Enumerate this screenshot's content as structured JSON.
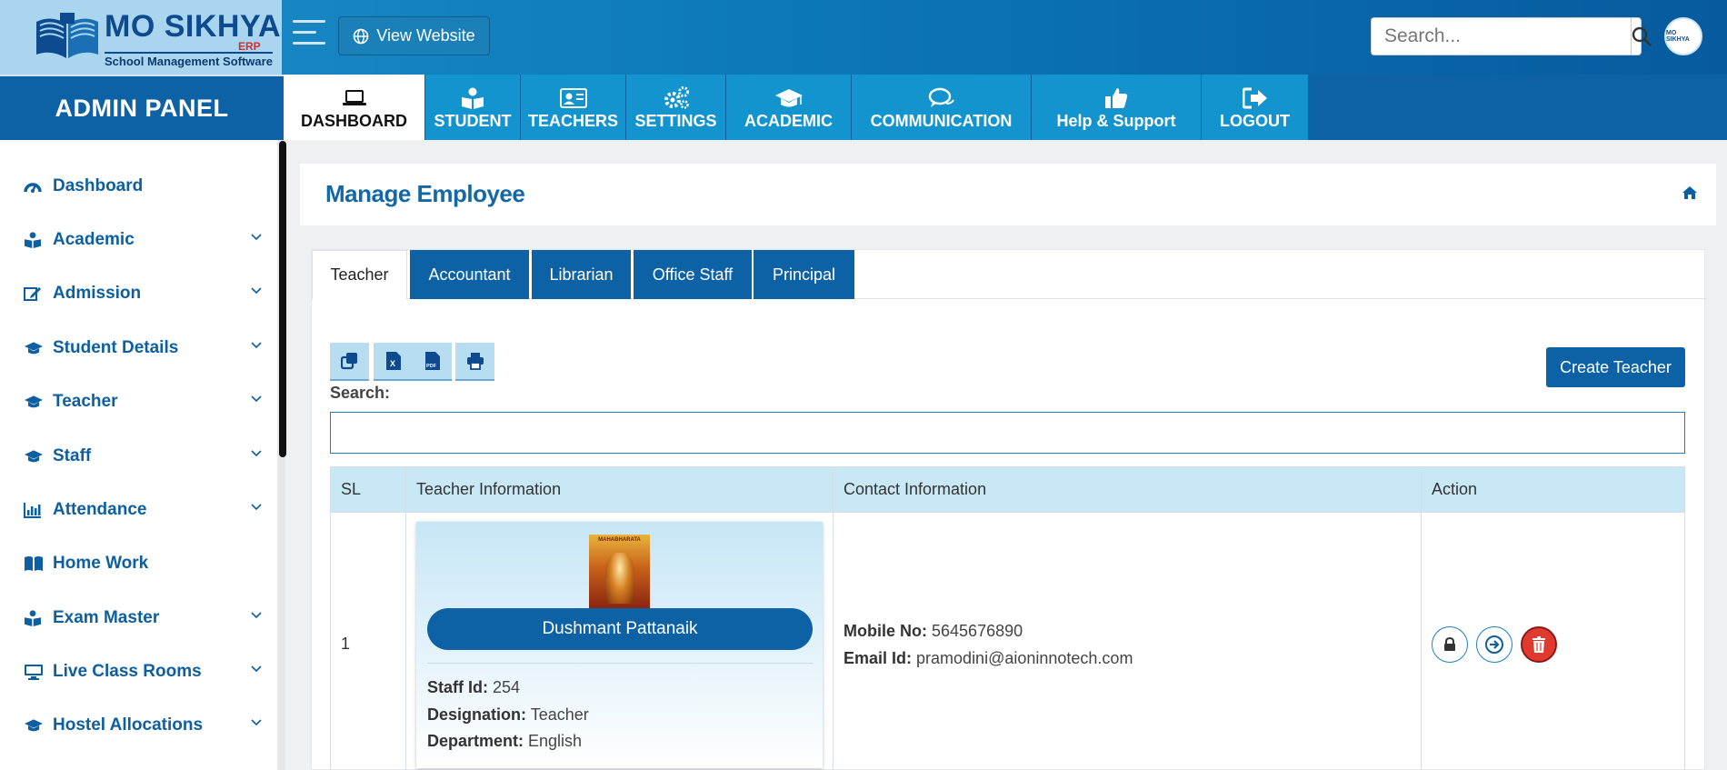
{
  "brand": {
    "name": "MO SIKHYA",
    "erp": "ERP",
    "tagline": "School Management Software",
    "avatar_text": "MO SIKHYA"
  },
  "header": {
    "view_website": "View Website",
    "search_placeholder": "Search..."
  },
  "admin_panel": "ADMIN PANEL",
  "nav": [
    {
      "label": "DASHBOARD",
      "icon": "laptop-icon",
      "active": true
    },
    {
      "label": "STUDENT",
      "icon": "reader-icon"
    },
    {
      "label": "TEACHERS",
      "icon": "id-card-icon"
    },
    {
      "label": "SETTINGS",
      "icon": "gears-icon"
    },
    {
      "label": "ACADEMIC",
      "icon": "graduation-cap-icon"
    },
    {
      "label": "COMMUNICATION",
      "icon": "chat-icon"
    },
    {
      "label": "Help & Support",
      "icon": "thumbs-up-icon"
    },
    {
      "label": "LOGOUT",
      "icon": "sign-out-icon"
    }
  ],
  "sidebar": {
    "items": [
      {
        "label": "Dashboard",
        "icon": "dashboard-icon",
        "has_children": false
      },
      {
        "label": "Academic",
        "icon": "reader-icon",
        "has_children": true
      },
      {
        "label": "Admission",
        "icon": "edit-icon",
        "has_children": true
      },
      {
        "label": "Student Details",
        "icon": "graduation-cap-icon",
        "has_children": true
      },
      {
        "label": "Teacher",
        "icon": "graduation-cap-icon",
        "has_children": true
      },
      {
        "label": "Staff",
        "icon": "graduation-cap-icon",
        "has_children": true
      },
      {
        "label": "Attendance",
        "icon": "bar-chart-icon",
        "has_children": true
      },
      {
        "label": "Home Work",
        "icon": "book-icon",
        "has_children": false
      },
      {
        "label": "Exam Master",
        "icon": "reader-icon",
        "has_children": true
      },
      {
        "label": "Live Class Rooms",
        "icon": "monitor-icon",
        "has_children": true
      },
      {
        "label": "Hostel Allocations",
        "icon": "graduation-cap-icon",
        "has_children": true
      }
    ]
  },
  "page": {
    "title": "Manage Employee",
    "tabs": [
      "Teacher",
      "Accountant",
      "Librarian",
      "Office Staff",
      "Principal"
    ],
    "active_tab": "Teacher",
    "tools": [
      "copy-icon",
      "excel-icon",
      "pdf-icon",
      "print-icon"
    ],
    "create_button": "Create Teacher",
    "search_label": "Search:",
    "search_value": ""
  },
  "table": {
    "headers": [
      "SL",
      "Teacher Information",
      "Contact Information",
      "Action"
    ],
    "rows": [
      {
        "sl": "1",
        "photo_caption": "MAHABHARATA",
        "name": "Dushmant Pattanaik",
        "staff_id_label": "Staff Id:",
        "staff_id": "254",
        "designation_label": "Designation:",
        "designation": "Teacher",
        "department_label": "Department:",
        "department": "English",
        "mobile_label": "Mobile No:",
        "mobile": "5645676890",
        "email_label": "Email Id:",
        "email": "pramodini@aioninnotech.com"
      }
    ]
  },
  "colors": {
    "primary": "#0d62a6",
    "nav_bg": "#1394cf",
    "accent_text": "#0d5fa0",
    "danger": "#e03a30",
    "table_header": "#c9e8f5"
  }
}
